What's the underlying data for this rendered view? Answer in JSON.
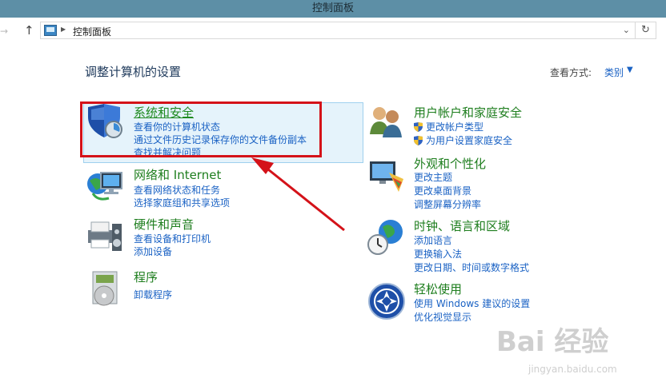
{
  "window": {
    "title": "控制面板"
  },
  "address": {
    "path": "控制面板"
  },
  "heading": "调整计算机的设置",
  "view_by": {
    "label": "查看方式:",
    "value": "类别"
  },
  "categories": {
    "system_security": {
      "title": "系统和安全",
      "links": [
        "查看你的计算机状态",
        "通过文件历史记录保存你的文件备份副本",
        "查找并解决问题"
      ]
    },
    "network": {
      "title": "网络和 Internet",
      "links": [
        "查看网络状态和任务",
        "选择家庭组和共享选项"
      ]
    },
    "hardware": {
      "title": "硬件和声音",
      "links": [
        "查看设备和打印机",
        "添加设备"
      ]
    },
    "programs": {
      "title": "程序",
      "links": [
        "卸载程序"
      ]
    },
    "user_accounts": {
      "title": "用户帐户和家庭安全",
      "links": [
        "更改帐户类型",
        "为用户设置家庭安全"
      ]
    },
    "appearance": {
      "title": "外观和个性化",
      "links": [
        "更改主题",
        "更改桌面背景",
        "调整屏幕分辨率"
      ]
    },
    "clock_region": {
      "title": "时钟、语言和区域",
      "links": [
        "添加语言",
        "更换输入法",
        "更改日期、时间或数字格式"
      ]
    },
    "ease_of_access": {
      "title": "轻松使用",
      "links": [
        "使用 Windows 建议的设置",
        "优化视觉显示"
      ]
    }
  },
  "watermark": {
    "brand": "Bai 经验",
    "url": "jingyan.baidu.com"
  },
  "colors": {
    "titlebar": "#5d8fa6",
    "category_green": "#1e7e1e",
    "link_blue": "#1a62c4",
    "annotation_red": "#d41219",
    "hover_bg": "#e5f3fb"
  }
}
